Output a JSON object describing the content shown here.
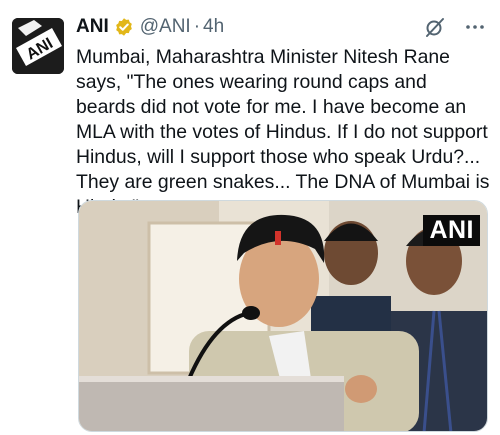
{
  "tweet": {
    "author_name": "ANI",
    "handle": "@ANI",
    "separator": "·",
    "time": "4h",
    "text": "Mumbai, Maharashtra Minister Nitesh Rane says, \"The ones wearing round caps and beards did not vote for me. I have become an MLA with the votes of Hindus. If I do not support Hindus, will I support those who speak Urdu?... They are green snakes... The DNA of Mumbai is Hindu.\""
  },
  "avatar": {
    "logo_text": "ANI"
  },
  "media": {
    "watermark": "ANI"
  },
  "icons": {
    "verified": "verified-badge-icon",
    "grok": "grok-icon",
    "more": "more-options-icon"
  },
  "colors": {
    "verified_badge": "#e2b719",
    "secondary_text": "#536471",
    "primary_text": "#0f1419"
  }
}
